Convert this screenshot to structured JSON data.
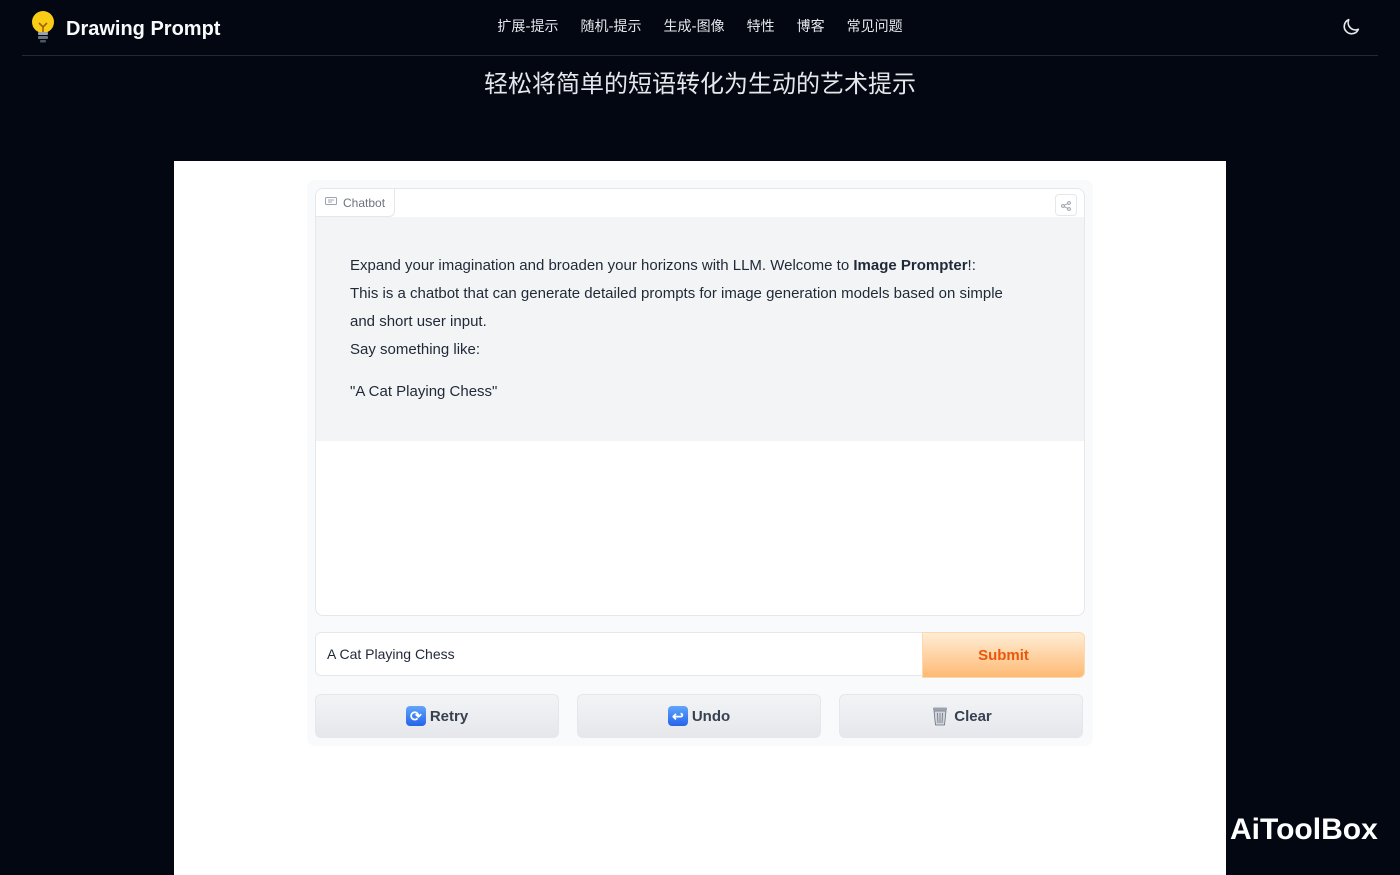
{
  "header": {
    "brand": "Drawing Prompt",
    "nav": [
      "扩展-提示",
      "随机-提示",
      "生成-图像",
      "特性",
      "博客",
      "常见问题"
    ],
    "theme_icon": "moon-icon"
  },
  "subtitle": "轻松将简单的短语转化为生动的艺术提示",
  "chatbot": {
    "label": "Chatbot",
    "message": {
      "line1_prefix": "Expand your imagination and broaden your horizons with LLM. Welcome to ",
      "line1_bold": "Image Prompter",
      "line1_suffix": "!:",
      "line2": "This is a chatbot that can generate detailed prompts for image generation models based on simple",
      "line3": "and short user input.",
      "line4": "Say something like:",
      "quote": "\"A Cat Playing Chess\""
    }
  },
  "input": {
    "value": "A Cat Playing Chess",
    "submit_label": "Submit"
  },
  "actions": {
    "retry": "Retry",
    "undo": "Undo",
    "clear": "Clear"
  },
  "watermark": {
    "text": "AiToolBox"
  },
  "colors": {
    "page_bg": "#030712",
    "submit_text": "#ea580c",
    "submit_bg": "#fdba74"
  }
}
